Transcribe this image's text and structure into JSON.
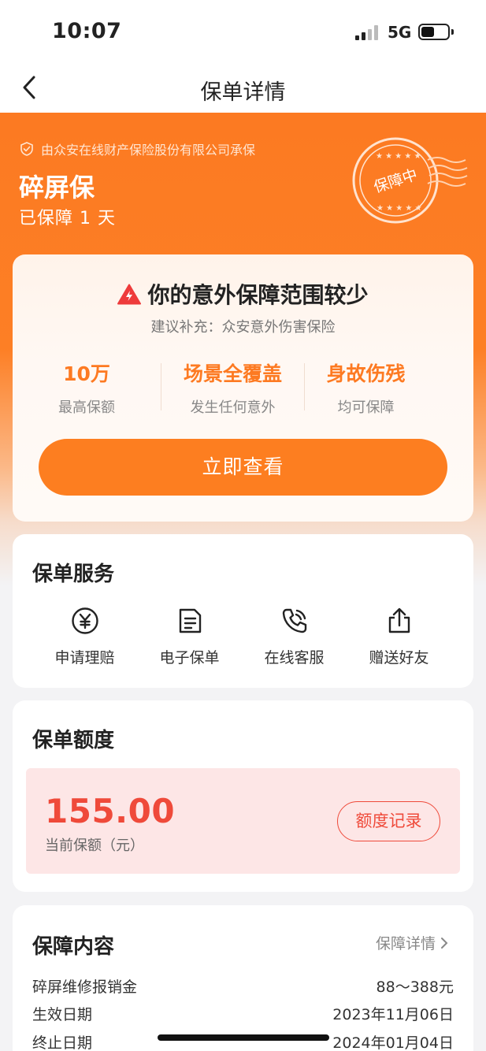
{
  "status_bar": {
    "time": "10:07",
    "network": "5G",
    "icons": [
      "signal-icon",
      "battery-icon"
    ]
  },
  "nav": {
    "title": "保单详情",
    "back_icon": "chevron-left-icon"
  },
  "hero": {
    "insurer": "由众安在线财产保险股份有限公司承保",
    "product": "碎屏保",
    "covered_days": "已保障 1 天",
    "stamp": "保障中"
  },
  "promo": {
    "title": "你的意外保障范围较少",
    "subtitle": "建议补充：众安意外伤害保险",
    "features": [
      {
        "value": "10万",
        "label": "最高保额"
      },
      {
        "value": "场景全覆盖",
        "label": "发生任何意外"
      },
      {
        "value": "身故伤残",
        "label": "均可保障"
      }
    ],
    "cta": "立即查看"
  },
  "services": {
    "title": "保单服务",
    "items": [
      {
        "label": "申请理赔",
        "icon": "yen-circle-icon"
      },
      {
        "label": "电子保单",
        "icon": "document-icon"
      },
      {
        "label": "在线客服",
        "icon": "phone-call-icon"
      },
      {
        "label": "赠送好友",
        "icon": "share-icon"
      }
    ]
  },
  "quota": {
    "title": "保单额度",
    "amount": "155.00",
    "amount_label": "当前保额（元）",
    "record_button": "额度记录"
  },
  "coverage": {
    "title": "保障内容",
    "detail_link": "保障详情",
    "rows": [
      {
        "label": "碎屏维修报销金",
        "value": "88～388元"
      },
      {
        "label": "生效日期",
        "value": "2023年11月06日"
      },
      {
        "label": "终止日期",
        "value": "2024年01月04日"
      }
    ]
  },
  "colors": {
    "brand_orange": "#fd7e20",
    "accent_red": "#ef4a3a"
  }
}
